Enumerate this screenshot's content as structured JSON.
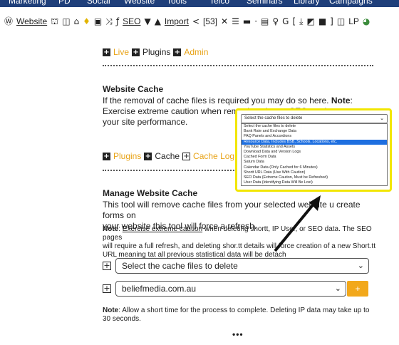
{
  "top_nav": {
    "items": [
      "Marketing",
      "PD",
      "Social",
      "Website",
      "Tools",
      "Telco",
      "Seminars",
      "Library",
      "Campaigns"
    ]
  },
  "toolbar": {
    "wordpress_icon": "wordpress-icon",
    "website_label": "Website",
    "seo_label": "SEO",
    "import_label": "Import",
    "count_label": "[53]",
    "lp_label": "LP"
  },
  "breadcrumb_top": {
    "live_label": "Live",
    "plugins_label": "Plugins",
    "admin_label": "Admin"
  },
  "website_cache": {
    "heading": "Website Cache",
    "para_before_note": "If the removal of cache files is required you may do so here.",
    "note_label": "Note",
    "para_after_note": ": Exercise extreme caution when removing shor.tt, SEO, and",
    "para_line3": "your site performance."
  },
  "popup": {
    "selected_value": "Select the cache files to delete",
    "options": [
      "Select the cache files to delete",
      "Bank Rate and Exchange Data",
      "FAQ Panels and Accordions",
      "Resource Data, Includes BSB, Schools, Locations, etc.",
      "YouTube Statistics and Assets",
      "Download Data and Version Logs",
      "Cached Form Data",
      "Saturn Data",
      "Calendar Data (Only Cached for 6 Minutes)",
      "Shortt URL Data (Use With Caution)",
      "SEO Data (Extreme Caution, Must be Refreshed)",
      "User Data (Identifying Data Will Be Lost)"
    ],
    "active_index": 3
  },
  "breadcrumb_mid": {
    "plugins_label": "Plugins",
    "cache_label": "Cache",
    "cache_log_label": "Cache Log"
  },
  "manage_cache": {
    "heading": "Manage Website Cache",
    "para_line1": "This tool will remove cache files from your selected website",
    "para_line1_tail": "u create forms on",
    "para_line2": "your website this tool will force a refresh.",
    "note_label": "Note",
    "note_colon": ": ",
    "note_link": "Exercise extreme caution",
    "note_text1": " when deleting shortt, IP User, or SEO data. The SEO pages",
    "note_text2": "will require a full refresh, and deleting shor.tt details will force",
    "note_text2_tail": "creation of a new Short.tt",
    "note_text3": "URL meaning tat all previous statistical data will be detach"
  },
  "form": {
    "cache_select_value": "Select the cache files to delete",
    "site_select_value": "beliefmedia.com.au",
    "add_button_label": "+"
  },
  "footer_note": {
    "note_label": "Note",
    "text": ": Allow a short time for the process to complete. Deleting IP data may take up to 30 seconds."
  },
  "ellipsis": "•••",
  "colors": {
    "nav_bg": "#1f3f7a",
    "accent_orange": "#e8a317",
    "highlight_yellow": "#f2e600",
    "option_active": "#1e6fe0"
  }
}
